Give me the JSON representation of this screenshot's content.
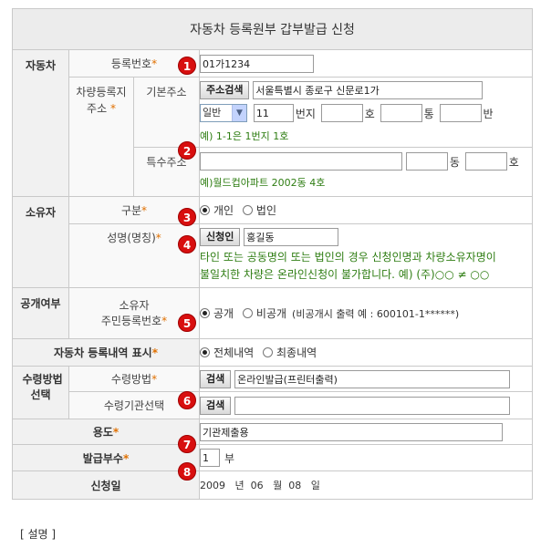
{
  "title": "자동차 등록원부 갑부발급 신청",
  "sections": {
    "vehicle": "자동차",
    "owner": "소유자",
    "disclosure": "공개여부",
    "registration_display": "자동차 등록내역 표시",
    "receipt": "수령방법 선택",
    "purpose": "용도",
    "copies": "발급부수",
    "apply_date": "신청일"
  },
  "required_mark": "*",
  "badges": [
    "1",
    "2",
    "3",
    "4",
    "5",
    "6",
    "7",
    "8"
  ],
  "reg_number": {
    "label": "등록번호",
    "value": "01가1234"
  },
  "address": {
    "label": "차량등록지 주소",
    "basic_label": "기본주소",
    "search_button": "주소검색",
    "basic_value": "서울특별시 종로구 신문로1가",
    "type_select": "일반",
    "lot_number": "11",
    "lot_unit": "번지",
    "ho_unit": "호",
    "tong_unit": "통",
    "ban_unit": "반",
    "example": "예) 1-1은 1번지 1호",
    "special_label": "특수주소",
    "special_dong_unit": "동",
    "special_ho_unit": "호",
    "special_example": "예)월드컵아파트 2002동 4호"
  },
  "owner_type": {
    "label": "구분",
    "options": [
      "개인",
      "법인"
    ],
    "selected": "개인"
  },
  "owner_name": {
    "label": "성명(명칭)",
    "button": "신청인",
    "value": "홍길동",
    "notice_line1": "타인 또는 공동명의 또는 법인의 경우 신청인명과 차량소유자명이",
    "notice_line2": "불일치한 차량은 온라인신청이 불가합니다. 예) (주)○○ ≠ ○○"
  },
  "disclosure": {
    "label_line1": "소유자",
    "label_line2": "주민등록번호",
    "options": [
      "공개",
      "비공개"
    ],
    "selected": "공개",
    "note": "(비공개시 출력 예 : 600101-1******)"
  },
  "registration_display": {
    "options": [
      "전체내역",
      "최종내역"
    ],
    "selected": "전체내역"
  },
  "receipt": {
    "method_label": "수령방법",
    "method_button": "검색",
    "method_value": "온라인발급(프린터출력)",
    "agency_label": "수령기관선택",
    "agency_button": "검색",
    "agency_value": ""
  },
  "purpose": {
    "value": "기관제출용"
  },
  "copies": {
    "value": "1",
    "unit": "부"
  },
  "apply_date": {
    "year": "2009",
    "year_unit": "년",
    "month": "06",
    "month_unit": "월",
    "day": "08",
    "day_unit": "일"
  },
  "footer": "[ 설명 ]"
}
